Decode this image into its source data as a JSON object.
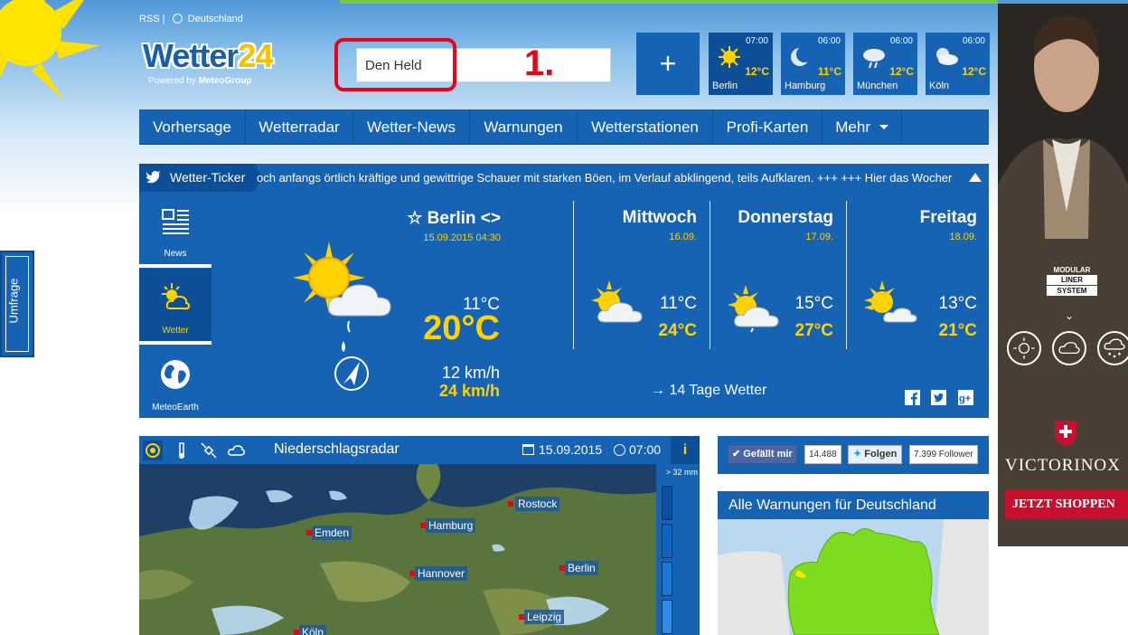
{
  "toplinks": {
    "rss": "RSS |",
    "country": "Deutschland"
  },
  "logo": {
    "main": "Wetter",
    "number": "24",
    "powered": "Powered by",
    "partner": "MeteoGroup"
  },
  "search": {
    "value": "Den Held"
  },
  "annotation": {
    "number": "1."
  },
  "add_city": {
    "label": "+"
  },
  "city_tiles": [
    {
      "time": "07:00",
      "temp": "12°C",
      "name": "Berlin",
      "icon": "sun-icon"
    },
    {
      "time": "06:00",
      "temp": "11°C",
      "name": "Hamburg",
      "icon": "moon-icon"
    },
    {
      "time": "06:00",
      "temp": "12°C",
      "name": "München",
      "icon": "cloud-rain-icon"
    },
    {
      "time": "06:00",
      "temp": "12°C",
      "name": "Köln",
      "icon": "moon-cloud-icon"
    }
  ],
  "nav": {
    "items": [
      "Vorhersage",
      "Wetterradar",
      "Wetter-News",
      "Warnungen",
      "Wetterstationen",
      "Profi-Karten",
      "Mehr"
    ]
  },
  "ticker": {
    "label": "Wetter-Ticker",
    "text": "och anfangs örtlich kräftige und gewittrige Schauer mit starken Böen, im Verlauf abklingend, teils Aufklaren. +++ +++ Hier das Wocher"
  },
  "side_tabs": [
    {
      "label": "News",
      "icon": "newspaper-icon"
    },
    {
      "label": "Wetter",
      "icon": "sun-cloud-icon"
    },
    {
      "label": "MeteoEarth",
      "icon": "globe-icon"
    }
  ],
  "today": {
    "city": "☆ Berlin <>",
    "datetime": "15.09.2015 04:30",
    "min_temp": "11°C",
    "max_temp": "20°C",
    "wind": "12 km/h",
    "gust": "24 km/h",
    "icon": "sun-cloud-rain-icon"
  },
  "forecast": [
    {
      "day": "Mittwoch",
      "date": "16.09.",
      "min": "11°C",
      "max": "24°C",
      "icon": "sun-cloud-icon"
    },
    {
      "day": "Donnerstag",
      "date": "17.09.",
      "min": "15°C",
      "max": "27°C",
      "icon": "sun-cloud-rain-icon"
    },
    {
      "day": "Freitag",
      "date": "18.09.",
      "min": "13°C",
      "max": "21°C",
      "icon": "sun-cloud-icon"
    }
  ],
  "tage_link": "→ 14 Tage Wetter",
  "radar": {
    "title": "Niederschlagsradar",
    "date": "15.09.2015",
    "time": "07:00",
    "info": "i",
    "legend_top": "> 32 mm",
    "cities": [
      "Rostock",
      "Emden",
      "Hamburg",
      "Hannover",
      "Berlin",
      "Leipzig",
      "Köln"
    ]
  },
  "social": {
    "fb_label": "Gefällt mir",
    "fb_count": "14.488",
    "tw_label": "Folgen",
    "tw_count": "7.399 Follower"
  },
  "warnings": {
    "title": "Alle Warnungen für Deutschland"
  },
  "umfrage": {
    "label": "Umfrage"
  },
  "ad": {
    "modular": "MODULAR",
    "liner": "LINER",
    "system": "SYSTEM",
    "brand": "VICTORINOX",
    "cta": "JETZT SHOPPEN"
  },
  "colors": {
    "primary_blue": "#1662b3",
    "dark_blue": "#0d4f97",
    "accent_yellow": "#ffd200",
    "annotation_red": "#e3061a",
    "warn_green": "#7ddc1f"
  }
}
